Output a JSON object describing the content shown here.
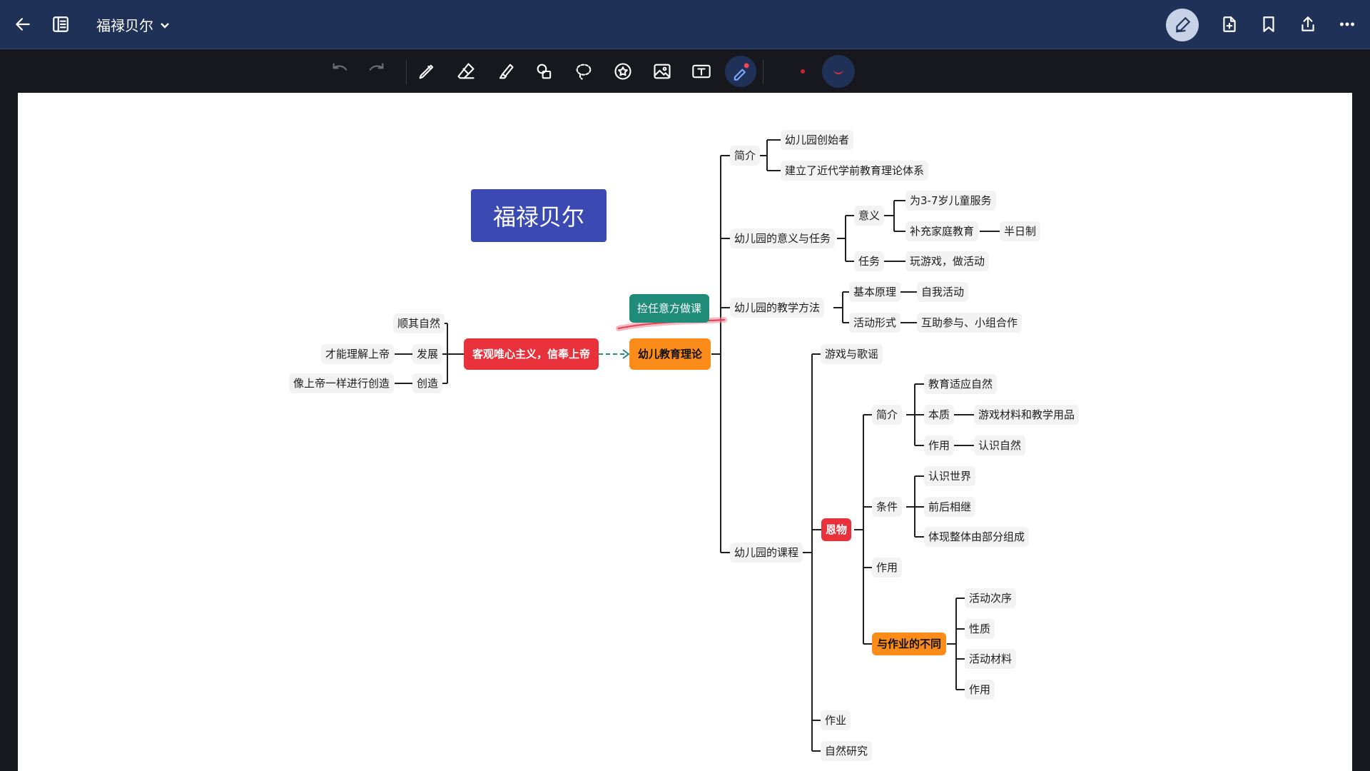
{
  "header": {
    "title": "福禄贝尔",
    "icons": [
      "back-arrow-icon",
      "sidebar-toggle-icon",
      "chevron-down-icon",
      "pen-mode-icon",
      "add-page-icon",
      "bookmark-icon",
      "share-icon",
      "more-icon"
    ]
  },
  "toolbar": {
    "tools": [
      "undo",
      "redo",
      "pen",
      "eraser",
      "highlighter",
      "shapes",
      "lasso",
      "sticker",
      "image",
      "text",
      "laser-pointer"
    ],
    "active_tool": "laser-pointer",
    "pen_color": "#e03040"
  },
  "mindmap": {
    "title": "福禄贝尔",
    "annotation": "捡任意方做课",
    "center": "幼儿教育理论",
    "left_main": "客观唯心主义，信奉上帝",
    "left": {
      "l1": "顺其自然",
      "l2": "发展",
      "l3": "创造",
      "l2_child": "才能理解上帝",
      "l3_child": "像上帝一样进行创造"
    },
    "intro": {
      "label": "简介",
      "c1": "幼儿园创始者",
      "c2": "建立了近代学前教育理论体系"
    },
    "meaning": {
      "label": "幼儿园的意义与任务",
      "yi": "意义",
      "yi_c1": "为3-7岁儿童服务",
      "yi_c2": "补充家庭教育",
      "yi_c2_child": "半日制",
      "task": "任务",
      "task_child": "玩游戏，做活动"
    },
    "method": {
      "label": "幼儿园的教学方法",
      "principle": "基本原理",
      "principle_child": "自我活动",
      "form": "活动形式",
      "form_child": "互助参与、小组合作"
    },
    "course": {
      "label": "幼儿园的课程",
      "games": "游戏与歌谣",
      "gift": "恩物",
      "gift_intro": "简介",
      "gi_1": "教育适应自然",
      "gi_2": "本质",
      "gi_2_child": "游戏材料和教学用品",
      "gi_3": "作用",
      "gi_3_child": "认识自然",
      "cond": "条件",
      "cond_1": "认识世界",
      "cond_2": "前后相继",
      "cond_3": "体现整体由部分组成",
      "effect": "作用",
      "diff": "与作业的不同",
      "diff_1": "活动次序",
      "diff_2": "性质",
      "diff_3": "活动材料",
      "diff_4": "作用",
      "homework": "作业",
      "nature": "自然研究"
    }
  }
}
